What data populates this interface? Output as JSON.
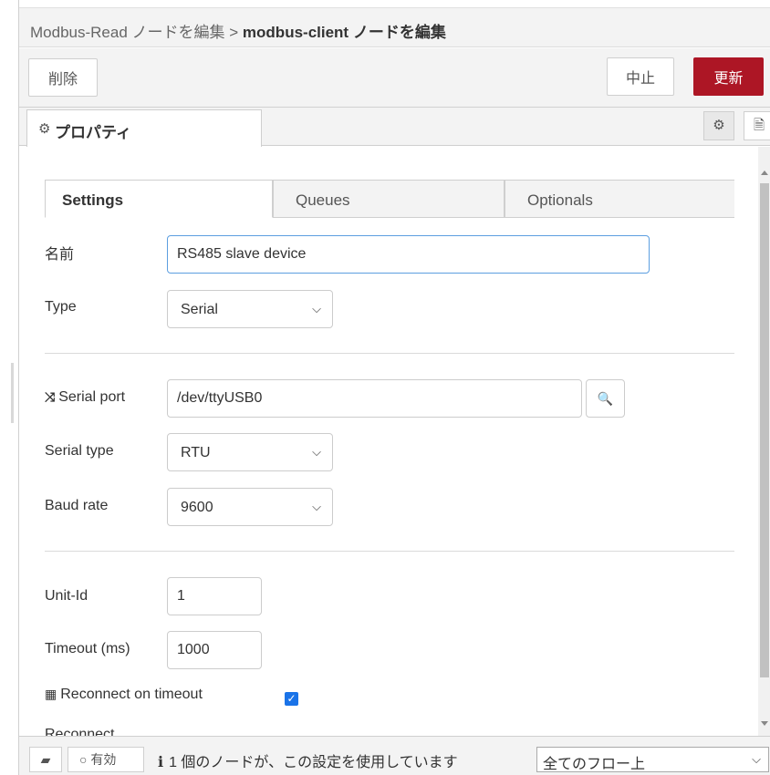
{
  "header": {
    "parent_node": "Modbus-Read ノードを編集",
    "separator": ">",
    "current_node": "modbus-client ノードを編集"
  },
  "toolbar": {
    "delete_label": "削除",
    "cancel_label": "中止",
    "update_label": "更新"
  },
  "tabs": {
    "properties_label": "プロパティ"
  },
  "subtabs": [
    "Settings",
    "Queues",
    "Optionals"
  ],
  "form": {
    "name": {
      "label": "名前",
      "value": "RS485 slave device"
    },
    "type": {
      "label": "Type",
      "value": "Serial"
    },
    "serial_port": {
      "label": "Serial port",
      "value": "/dev/ttyUSB0"
    },
    "serial_type": {
      "label": "Serial type",
      "value": "RTU"
    },
    "baud_rate": {
      "label": "Baud rate",
      "value": "9600"
    },
    "unit_id": {
      "label": "Unit-Id",
      "value": "1"
    },
    "timeout": {
      "label": "Timeout (ms)",
      "value": "1000"
    },
    "reconnect_on_timeout": {
      "label": "Reconnect on timeout",
      "checked": true
    },
    "reconnect_partial_label": "Reconnect"
  },
  "footer": {
    "enabled_label": "有効",
    "usage_text": "1 個のノードが、この設定を使用しています",
    "scope_value": "全てのフロー上"
  },
  "colors": {
    "update_button": "#ad1625",
    "checkbox": "#1a73e8",
    "focus_border": "#5c9ee0"
  },
  "icons": [
    "cog-icon",
    "document-icon",
    "random-icon",
    "search-icon",
    "th-icon",
    "book-icon",
    "circle-icon",
    "info-icon"
  ]
}
